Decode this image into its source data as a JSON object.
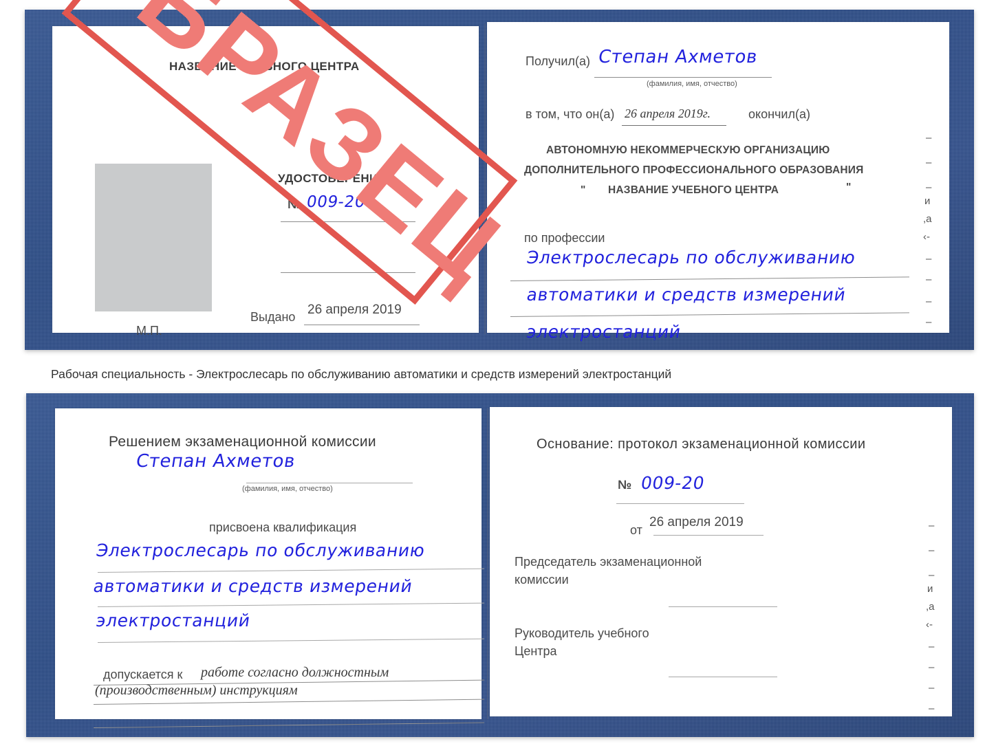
{
  "caption": "Рабочая специальность - Электрослесарь по обслуживанию автоматики и средств измерений электростанций",
  "watermark": {
    "text": "ОБРАЗЕЦ",
    "border_color": "#e2564f",
    "text_color": "#ef7b76"
  },
  "colors": {
    "binding_blue": "#1f4383",
    "handwriting_blue": "#2222dd",
    "print_gray": "#4a4a4a",
    "photo_placeholder": "#c9cbcc"
  },
  "certificate_top": {
    "left_page": {
      "center_name": "НАЗВАНИЕ УЧЕБНОГО ЦЕНТРА",
      "doc_type": "УДОСТОВЕРЕНИЕ",
      "number_label": "№",
      "number_value": "009-20",
      "issued_label": "Выдано",
      "issued_date": "26 апреля 2019",
      "seal_label": "М.П."
    },
    "right_page": {
      "received_label": "Получил(а)",
      "received_name": "Степан Ахметов",
      "name_hint": "(фамилия, имя, отчество)",
      "that_he_label": "в том, что он(а)",
      "completion_date": "26 апреля 2019г.",
      "finished_label": "окончил(а)",
      "org_line1": "АВТОНОМНУЮ НЕКОММЕРЧЕСКУЮ ОРГАНИЗАЦИЮ",
      "org_line2": "ДОПОЛНИТЕЛЬНОГО ПРОФЕССИОНАЛЬНОГО ОБРАЗОВАНИЯ",
      "org_quote_open": "\"",
      "org_line3": "НАЗВАНИЕ УЧЕБНОГО ЦЕНТРА",
      "org_quote_close": "\"",
      "profession_label": "по профессии",
      "profession_line1": "Электрослесарь по обслуживанию",
      "profession_line2": "автоматики и средств измерений",
      "profession_line3": "электростанций",
      "margin_glyphs": [
        "–",
        "–",
        "–",
        "и",
        ",а",
        "‹-",
        "–",
        "–",
        "–",
        "–"
      ]
    }
  },
  "certificate_bottom": {
    "left_page": {
      "heading": "Решением экзаменационной комиссии",
      "name": "Степан Ахметов",
      "name_hint": "(фамилия, имя, отчество)",
      "qualification_label": "присвоена квалификация",
      "qualification_line1": "Электрослесарь по обслуживанию",
      "qualification_line2": "автоматики и средств измерений",
      "qualification_line3": "электростанций",
      "admitted_label": "допускается к",
      "admitted_line1": "работе согласно должностным",
      "admitted_line2": "(производственным) инструкциям"
    },
    "right_page": {
      "basis_label": "Основание: протокол экзаменационной комиссии",
      "number_label": "№",
      "number_value": "009-20",
      "date_label": "от",
      "date_value": "26 апреля 2019",
      "chairman_line1": "Председатель экзаменационной",
      "chairman_line2": "комиссии",
      "head_line1": "Руководитель учебного",
      "head_line2": "Центра",
      "margin_glyphs": [
        "–",
        "–",
        "–",
        "и",
        ",а",
        "‹-",
        "–",
        "–",
        "–",
        "–"
      ]
    }
  }
}
